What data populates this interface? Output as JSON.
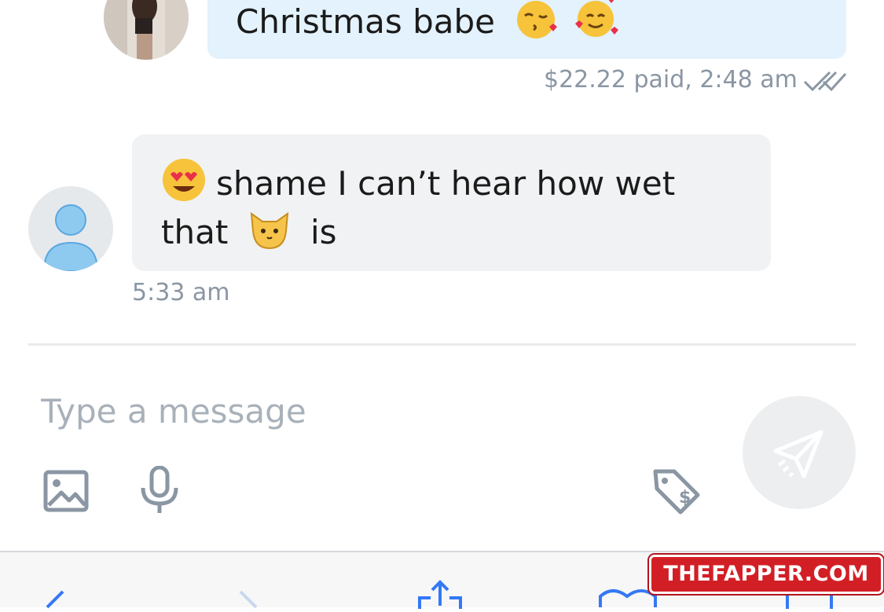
{
  "sent_message": {
    "text": "Christmas babe",
    "emojis": [
      "kissing-face-icon",
      "smiling-face-with-hearts-icon"
    ],
    "meta": "$22.22 paid, 2:48 am",
    "status_icon": "double-check-icon"
  },
  "received_message": {
    "line1": "shame I can’t hear how wet",
    "line2_before": "that",
    "line2_after": "is",
    "emojis": [
      "heart-eyes-face-icon",
      "cat-face-icon"
    ],
    "time": "5:33 am"
  },
  "composer": {
    "placeholder": "Type a message",
    "value": ""
  },
  "watermark": {
    "text": "THEFAPPER.COM"
  },
  "colors": {
    "sent_bubble": "#e3f2fc",
    "received_bubble": "#f1f2f3",
    "meta_text": "#8a96a3",
    "icon_gray": "#8a96a3",
    "watermark_red": "#d21f26",
    "ios_blue": "#3478f6"
  }
}
